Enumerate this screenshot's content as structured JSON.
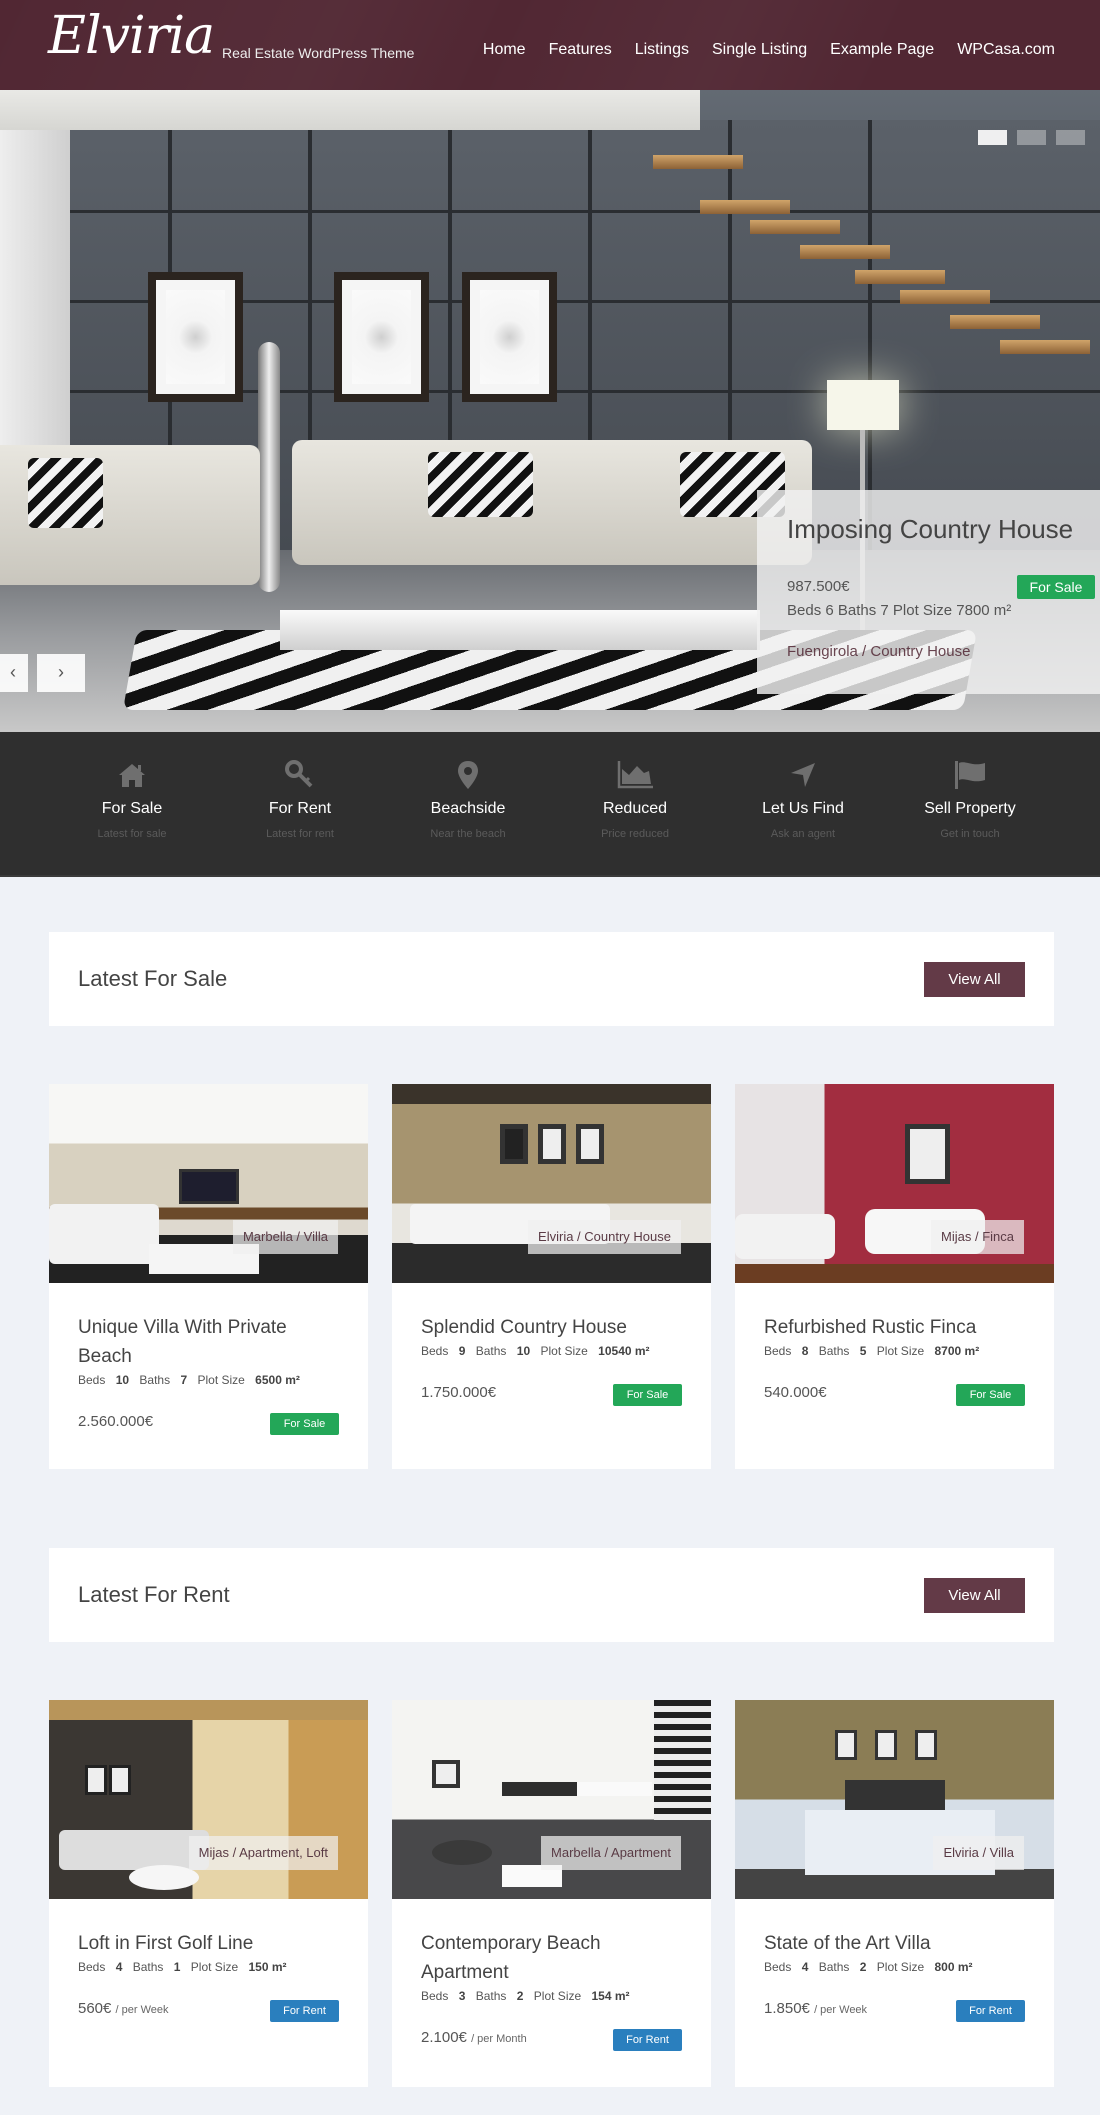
{
  "site": {
    "logo": "Elviria",
    "tagline": "Real Estate WordPress Theme",
    "brand_color": "#512733",
    "accent_button_color": "#633a47"
  },
  "nav": {
    "items": [
      "Home",
      "Features",
      "Listings",
      "Single Listing",
      "Example Page",
      "WPCasa.com"
    ]
  },
  "slider": {
    "slide_count": 3,
    "active_slide": 1,
    "prev_label": "‹",
    "next_label": "›",
    "caption": {
      "title": "Imposing Country House",
      "price": "987.500€",
      "specs": "Beds 6 Baths 7 Plot Size 7800 m²",
      "location": "Fuengirola / Country House",
      "badge": "For Sale"
    }
  },
  "features": [
    {
      "icon": "home-icon",
      "title": "For Sale",
      "subtitle": "Latest for sale"
    },
    {
      "icon": "key-icon",
      "title": "For Rent",
      "subtitle": "Latest for rent"
    },
    {
      "icon": "map-pin-icon",
      "title": "Beachside",
      "subtitle": "Near the beach"
    },
    {
      "icon": "area-chart-icon",
      "title": "Reduced",
      "subtitle": "Price reduced"
    },
    {
      "icon": "location-arrow-icon",
      "title": "Let Us Find",
      "subtitle": "Ask an agent"
    },
    {
      "icon": "flag-icon",
      "title": "Sell Property",
      "subtitle": "Get in touch"
    }
  ],
  "sections": {
    "sale": {
      "title": "Latest For Sale",
      "button": "View All"
    },
    "rent": {
      "title": "Latest For Rent",
      "button": "View All"
    }
  },
  "spec_labels": {
    "beds": "Beds",
    "baths": "Baths",
    "plot": "Plot Size"
  },
  "sale_listings": [
    {
      "title": "Unique Villa With Private Beach",
      "tag": "Marbella / Villa",
      "beds": "10",
      "baths": "7",
      "plot": "6500 m²",
      "price": "2.560.000€",
      "period": "",
      "badge": "For Sale"
    },
    {
      "title": "Splendid Country House",
      "tag": "Elviria / Country House",
      "beds": "9",
      "baths": "10",
      "plot": "10540 m²",
      "price": "1.750.000€",
      "period": "",
      "badge": "For Sale"
    },
    {
      "title": "Refurbished Rustic Finca",
      "tag": "Mijas / Finca",
      "beds": "8",
      "baths": "5",
      "plot": "8700 m²",
      "price": "540.000€",
      "period": "",
      "badge": "For Sale"
    }
  ],
  "rent_listings": [
    {
      "title": "Loft in First Golf Line",
      "tag": "Mijas / Apartment, Loft",
      "beds": "4",
      "baths": "1",
      "plot": "150 m²",
      "price": "560€",
      "period": "/ per Week",
      "badge": "For Rent"
    },
    {
      "title": "Contemporary Beach Apartment",
      "tag": "Marbella / Apartment",
      "beds": "3",
      "baths": "2",
      "plot": "154 m²",
      "price": "2.100€",
      "period": "/ per Month",
      "badge": "For Rent"
    },
    {
      "title": "State of the Art Villa",
      "tag": "Elviria / Villa",
      "beds": "4",
      "baths": "2",
      "plot": "800 m²",
      "price": "1.850€",
      "period": "/ per Week",
      "badge": "For Rent"
    }
  ],
  "badge_colors": {
    "sale": "#23a758",
    "rent": "#2a7fbe"
  }
}
